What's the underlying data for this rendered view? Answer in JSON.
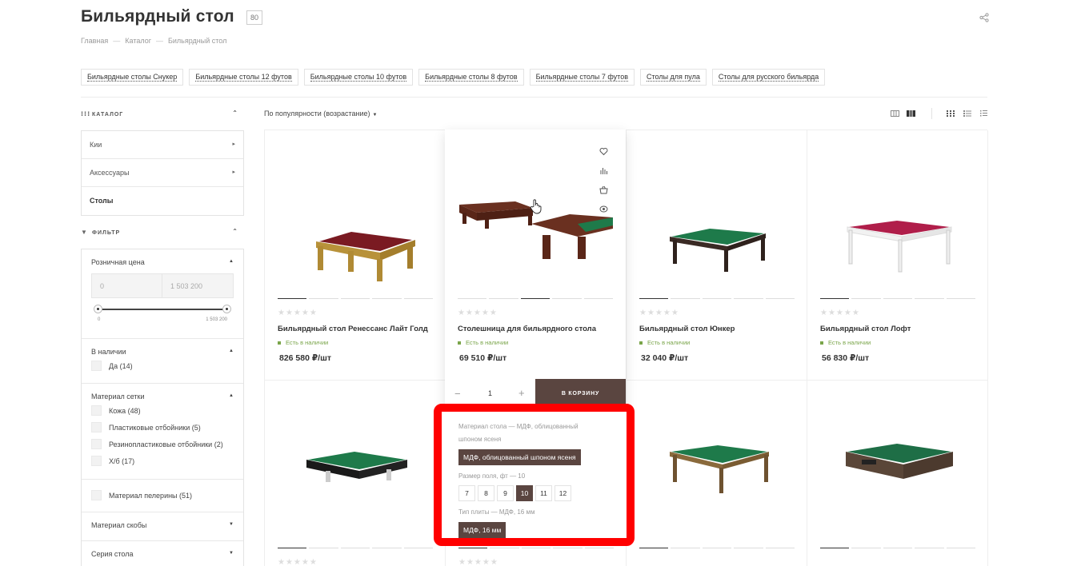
{
  "header": {
    "title": "Бильярдный стол",
    "count": "80",
    "breadcrumb": [
      "Главная",
      "Каталог",
      "Бильярдный стол"
    ],
    "breadcrumb_sep": "—"
  },
  "tags": [
    "Бильярдные столы Снукер",
    "Бильярдные столы 12 футов",
    "Бильярдные столы 10 футов",
    "Бильярдные столы 8 футов",
    "Бильярдные столы 7 футов",
    "Столы для пула",
    "Столы для русского бильярда"
  ],
  "sidebar": {
    "catalog_title": "КАТАЛОГ",
    "catalog_items": [
      "Кии",
      "Аксессуары",
      "Столы"
    ],
    "filter_title": "ФИЛЬТР",
    "price": {
      "title": "Розничная цена",
      "min_placeholder": "0",
      "max_placeholder": "1 503 200",
      "min_label": "0",
      "max_label": "1 503 200"
    },
    "availability": {
      "title": "В наличии",
      "options": [
        "Да (14)"
      ]
    },
    "net_material": {
      "title": "Материал сетки",
      "options": [
        "Кожа (48)",
        "Пластиковые отбойники (5)",
        "Резинопластиковые отбойники (2)",
        "Х/б (17)"
      ]
    },
    "pellet_material": "Материал пелерины (51)",
    "bracket_material": "Материал скобы",
    "table_series": "Серия стола"
  },
  "toolbar": {
    "sort_label": "По популярности (возрастание)"
  },
  "products": [
    {
      "name": "Бильярдный стол Ренессанс Лайт Голд",
      "stock": "Есть в наличии",
      "price": "826 580 ₽/шт"
    },
    {
      "name": "Столешница для бильярдного стола",
      "stock": "Есть в наличии",
      "price": "69 510 ₽/шт"
    },
    {
      "name": "Бильярдный стол Юнкер",
      "stock": "Есть в наличии",
      "price": "32 040 ₽/шт"
    },
    {
      "name": "Бильярдный стол Лофт",
      "stock": "Есть в наличии",
      "price": "56 830 ₽/шт"
    }
  ],
  "stars": "★★★★★",
  "hover_card": {
    "qty": "1",
    "minus": "−",
    "plus": "+",
    "cart_label": "В КОРЗИНУ"
  },
  "props": {
    "table_material_label": "Материал стола — МДФ, облицованный шпоном ясеня",
    "table_material_value": "МДФ, облицованный шпоном ясеня",
    "field_size_label": "Размер поля, фт — 10",
    "field_sizes": [
      "7",
      "8",
      "9",
      "10",
      "11",
      "12"
    ],
    "selected_size": "10",
    "slab_type_label": "Тип плиты — МДФ, 16 мм",
    "slab_type_value": "МДФ, 16 мм"
  }
}
